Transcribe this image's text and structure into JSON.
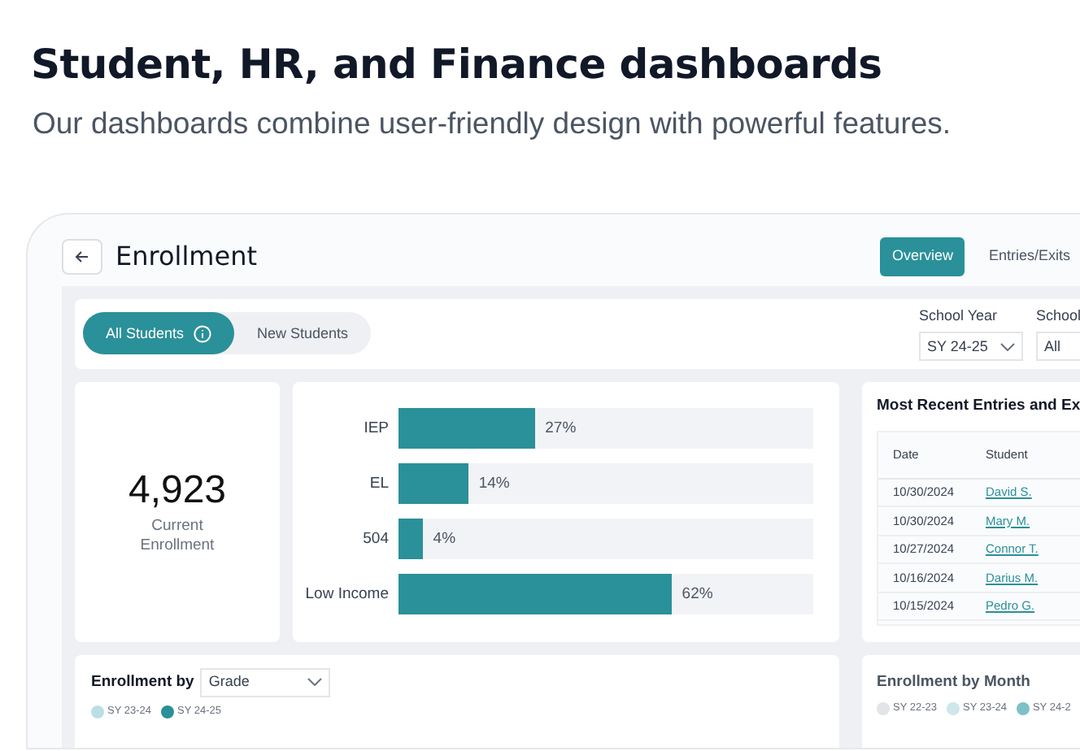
{
  "heading": "Student, HR, and Finance dashboards",
  "subheading": "Our dashboards combine user-friendly design with powerful features.",
  "app": {
    "title": "Enrollment",
    "tabs": [
      {
        "label": "Overview",
        "selected": true
      },
      {
        "label": "Entries/Exits",
        "selected": false
      }
    ],
    "toggles": [
      {
        "label": "All Students",
        "selected": true,
        "info": true
      },
      {
        "label": "New Students",
        "selected": false,
        "info": false
      }
    ],
    "filters": [
      {
        "label": "School Year",
        "value": "SY 24-25"
      },
      {
        "label": "School",
        "value": "All"
      }
    ],
    "kpi": {
      "value": "4,923",
      "label": "Current Enrollment"
    },
    "bars": [
      {
        "label": "IEP",
        "level": 0.33,
        "reading": "27%"
      },
      {
        "label": "EL",
        "level": 0.17,
        "reading": "14%"
      },
      {
        "label": "504",
        "level": 0.06,
        "reading": "4%"
      },
      {
        "label": "Low Income",
        "level": 0.66,
        "reading": "62%"
      }
    ],
    "recent": {
      "title": "Most Recent Entries and Ex",
      "columns": [
        "Date",
        "Student"
      ],
      "rows": [
        [
          "10/30/2024",
          "David S."
        ],
        [
          "10/30/2024",
          "Mary M."
        ],
        [
          "10/27/2024",
          "Connor T."
        ],
        [
          "10/16/2024",
          "Darius M."
        ],
        [
          "10/15/2024",
          "Pedro G."
        ]
      ]
    },
    "by_grade": {
      "title": "Enrollment by",
      "select": "Grade",
      "legend": [
        {
          "label": "SY 23-24",
          "color": "#b9dfe3"
        },
        {
          "label": "SY 24-25",
          "color": "#2a9099"
        }
      ]
    },
    "by_month": {
      "title": "Enrollment by Month",
      "legend": [
        {
          "label": "SY 22-23",
          "color": "#e2e4e7"
        },
        {
          "label": "SY 23-24",
          "color": "#cfe6ea"
        },
        {
          "label": "SY 24-2",
          "color": "#7fc0c7"
        }
      ]
    }
  }
}
